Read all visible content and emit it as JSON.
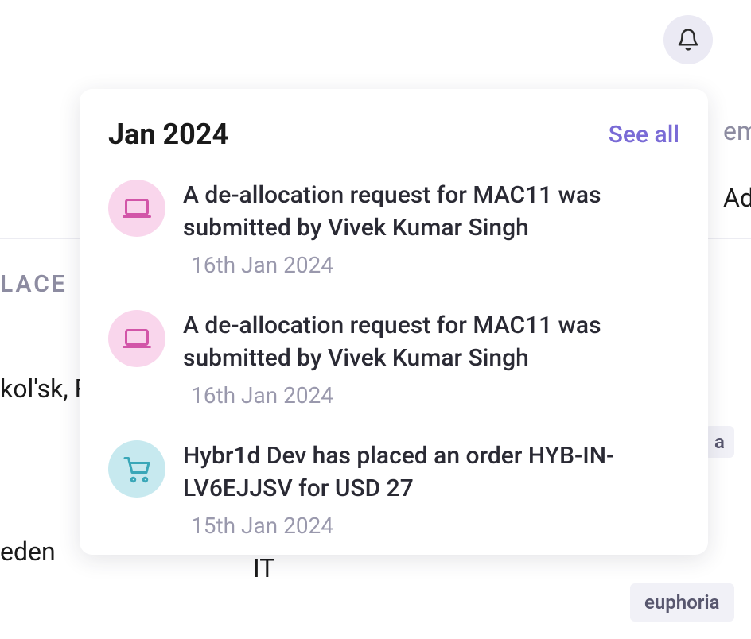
{
  "panel": {
    "title": "Jan 2024",
    "see_all": "See all",
    "notifications": [
      {
        "icon": "laptop",
        "text": "A de-allocation request for MAC11 was submitted by Vivek Kumar Singh",
        "date": "16th Jan 2024"
      },
      {
        "icon": "laptop",
        "text": "A de-allocation request for MAC11 was submitted by Vivek Kumar Singh",
        "date": "16th Jan 2024"
      },
      {
        "icon": "cart",
        "text": "Hybr1d Dev has placed an order HYB-IN-LV6EJJSV for USD 27",
        "date": "15th Jan 2024"
      }
    ]
  },
  "background": {
    "right_muted": "em",
    "right_text": "Ad",
    "label_place": "LACE",
    "kolsk": "kol'sk, Ru",
    "eden": "eden",
    "it": "IT",
    "tag_a": "a",
    "tag_euphoria": "euphoria"
  }
}
